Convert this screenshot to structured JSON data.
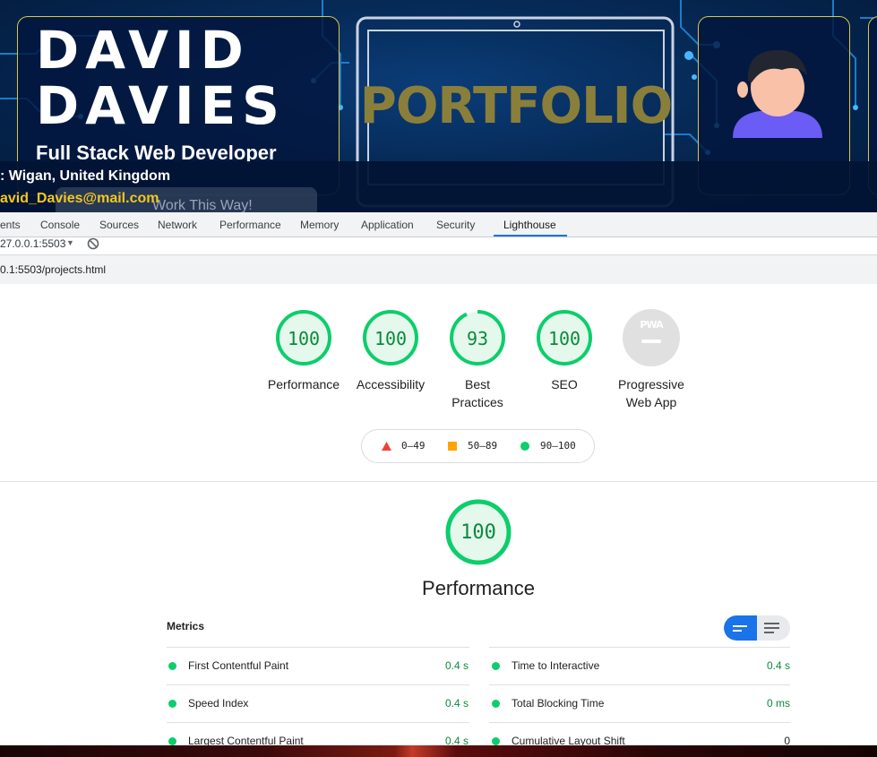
{
  "site": {
    "name_line_1": "DAVID",
    "name_line_2": "DAVIES",
    "role": "Full Stack Web Developer",
    "portfolio_title": "PORTFOLIO",
    "location": ": Wigan, United Kingdom",
    "email": "avid_Davies@mail.com",
    "button_text": "Work This Way!",
    "colors": {
      "accent_gold": "#d8c84a",
      "email": "#f3c61f",
      "title": "#8a7f3a"
    }
  },
  "devtools": {
    "tabs": [
      {
        "label": "ents"
      },
      {
        "label": "Console"
      },
      {
        "label": "Sources"
      },
      {
        "label": "Network"
      },
      {
        "label": "Performance"
      },
      {
        "label": "Memory"
      },
      {
        "label": "Application"
      },
      {
        "label": "Security"
      },
      {
        "label": "Lighthouse",
        "active": true
      }
    ],
    "url_select": "27.0.0.1:5503",
    "report_url": "0.1:5503/projects.html"
  },
  "lighthouse": {
    "categories": [
      {
        "label_1": "Performance",
        "label_2": "",
        "score": 100
      },
      {
        "label_1": "Accessibility",
        "label_2": "",
        "score": 100
      },
      {
        "label_1": "Best",
        "label_2": "Practices",
        "score": 93
      },
      {
        "label_1": "SEO",
        "label_2": "",
        "score": 100
      },
      {
        "label_1": "Progressive",
        "label_2": "Web App",
        "score": null,
        "badge": "PWA"
      }
    ],
    "legend": [
      {
        "label": "0–49",
        "color": "#eb4436"
      },
      {
        "label": "50–89",
        "color": "#ffa400"
      },
      {
        "label": "90–100",
        "color": "#0cce6b"
      }
    ],
    "section": {
      "score": 100,
      "label": "Performance",
      "metrics_title": "Metrics"
    },
    "metrics_left": [
      {
        "name": "First Contentful Paint",
        "value": "0.4 s"
      },
      {
        "name": "Speed Index",
        "value": "0.4 s"
      },
      {
        "name": "Largest Contentful Paint",
        "value": "0.4 s"
      }
    ],
    "metrics_right": [
      {
        "name": "Time to Interactive",
        "value": "0.4 s"
      },
      {
        "name": "Total Blocking Time",
        "value": "0 ms"
      },
      {
        "name": "Cumulative Layout Shift",
        "value": "0"
      }
    ],
    "colors": {
      "pass": "#0cce6b",
      "pass_text": "#0a8a3c",
      "pass_fill": "#e5f8ec",
      "toggle": "#1a73e8"
    }
  }
}
